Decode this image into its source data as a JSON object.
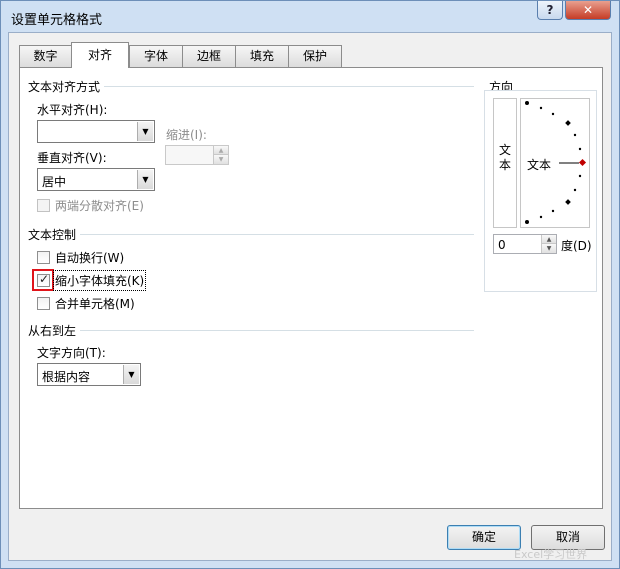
{
  "window": {
    "title": "设置单元格格式",
    "help_label": "?",
    "close_label": "✕"
  },
  "tabs": [
    {
      "label": "数字"
    },
    {
      "label": "对齐"
    },
    {
      "label": "字体"
    },
    {
      "label": "边框"
    },
    {
      "label": "填充"
    },
    {
      "label": "保护"
    }
  ],
  "active_tab": "对齐",
  "text_alignment": {
    "section_title": "文本对齐方式",
    "horizontal_label": "水平对齐(H):",
    "horizontal_value": "",
    "indent_label": "缩进(I):",
    "indent_value": "",
    "vertical_label": "垂直对齐(V):",
    "vertical_value": "居中",
    "justify_distributed_label": "两端分散对齐(E)"
  },
  "text_control": {
    "section_title": "文本控制",
    "wrap_label": "自动换行(W)",
    "wrap_checked": false,
    "shrink_label": "缩小字体填充(K)",
    "shrink_checked": true,
    "merge_label": "合并单元格(M)",
    "merge_checked": false
  },
  "rtl": {
    "section_title": "从右到左",
    "direction_label": "文字方向(T):",
    "direction_value": "根据内容"
  },
  "orientation": {
    "section_title": "方向",
    "vertical_text": "文本",
    "rotated_text": "文本",
    "degrees_value": "0",
    "degrees_label": "度(D)"
  },
  "buttons": {
    "ok_label": "确定",
    "cancel_label": "取消"
  },
  "watermark": "Excel学习世界",
  "colors": {
    "highlight_box": "#e0141a",
    "indicator": "#c00000"
  }
}
